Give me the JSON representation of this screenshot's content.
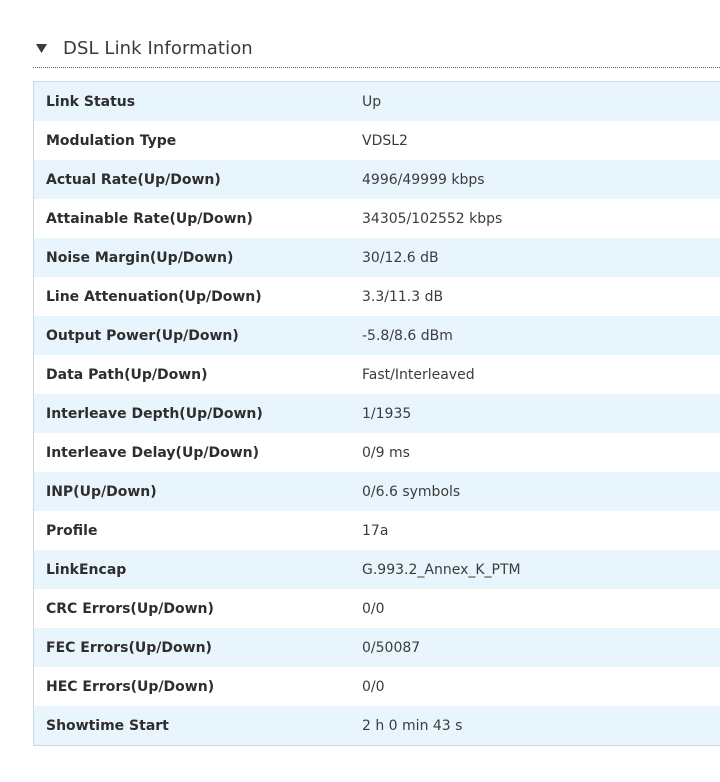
{
  "section": {
    "title": "DSL Link Information",
    "toggle_icon": "triangle-down-icon"
  },
  "rows": [
    {
      "label": "Link Status",
      "value": "Up"
    },
    {
      "label": "Modulation Type",
      "value": "VDSL2"
    },
    {
      "label": "Actual Rate(Up/Down)",
      "value": "4996/49999 kbps"
    },
    {
      "label": "Attainable Rate(Up/Down)",
      "value": "34305/102552 kbps"
    },
    {
      "label": "Noise Margin(Up/Down)",
      "value": "30/12.6 dB"
    },
    {
      "label": "Line Attenuation(Up/Down)",
      "value": "3.3/11.3 dB"
    },
    {
      "label": "Output Power(Up/Down)",
      "value": "-5.8/8.6 dBm"
    },
    {
      "label": "Data Path(Up/Down)",
      "value": "Fast/Interleaved"
    },
    {
      "label": "Interleave Depth(Up/Down)",
      "value": "1/1935"
    },
    {
      "label": "Interleave Delay(Up/Down)",
      "value": "0/9 ms"
    },
    {
      "label": "INP(Up/Down)",
      "value": "0/6.6 symbols"
    },
    {
      "label": "Profile",
      "value": "17a"
    },
    {
      "label": "LinkEncap",
      "value": "G.993.2_Annex_K_PTM"
    },
    {
      "label": "CRC Errors(Up/Down)",
      "value": "0/0"
    },
    {
      "label": "FEC Errors(Up/Down)",
      "value": "0/50087"
    },
    {
      "label": "HEC Errors(Up/Down)",
      "value": "0/0"
    },
    {
      "label": "Showtime Start",
      "value": "2 h 0 min 43 s"
    }
  ],
  "colors": {
    "row_alt": "#e9f5fc",
    "border": "#cfd6dc"
  }
}
